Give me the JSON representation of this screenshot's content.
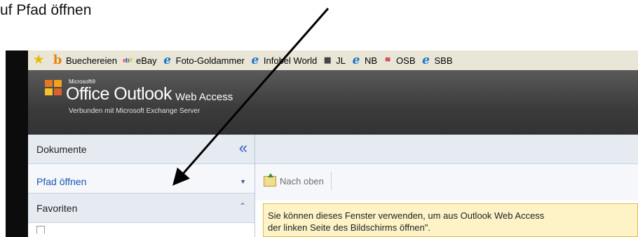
{
  "caption": "uf Pfad öffnen",
  "bookmarks": [
    {
      "label": "Buechereien",
      "icon": "b-icon"
    },
    {
      "label": "eBay",
      "icon": "ebay-icon"
    },
    {
      "label": "Foto-Goldammer",
      "icon": "ie-icon"
    },
    {
      "label": "Infobel World",
      "icon": "ie-icon"
    },
    {
      "label": "JL",
      "icon": "jl-icon"
    },
    {
      "label": "NB",
      "icon": "ie-icon"
    },
    {
      "label": "OSB",
      "icon": "osb-icon"
    },
    {
      "label": "SBB",
      "icon": "ie-icon"
    }
  ],
  "header": {
    "microsoft": "Microsoft®",
    "office": "Office Outlook",
    "product": "Web Access",
    "connected": "Verbunden mit Microsoft Exchange Server"
  },
  "sidebar": {
    "dokumente": "Dokumente",
    "pfad_oeffnen": "Pfad öffnen",
    "favoriten": "Favoriten"
  },
  "toolbar": {
    "up_label": "Nach oben"
  },
  "info": {
    "line1": "Sie können dieses Fenster verwenden, um aus Outlook Web Access",
    "line2": "der linken Seite des Bildschirms öffnen\"."
  },
  "colors": {
    "banner": "#3b3b3b",
    "link_blue": "#1a56b0",
    "info_bg": "#fdf3c7"
  }
}
